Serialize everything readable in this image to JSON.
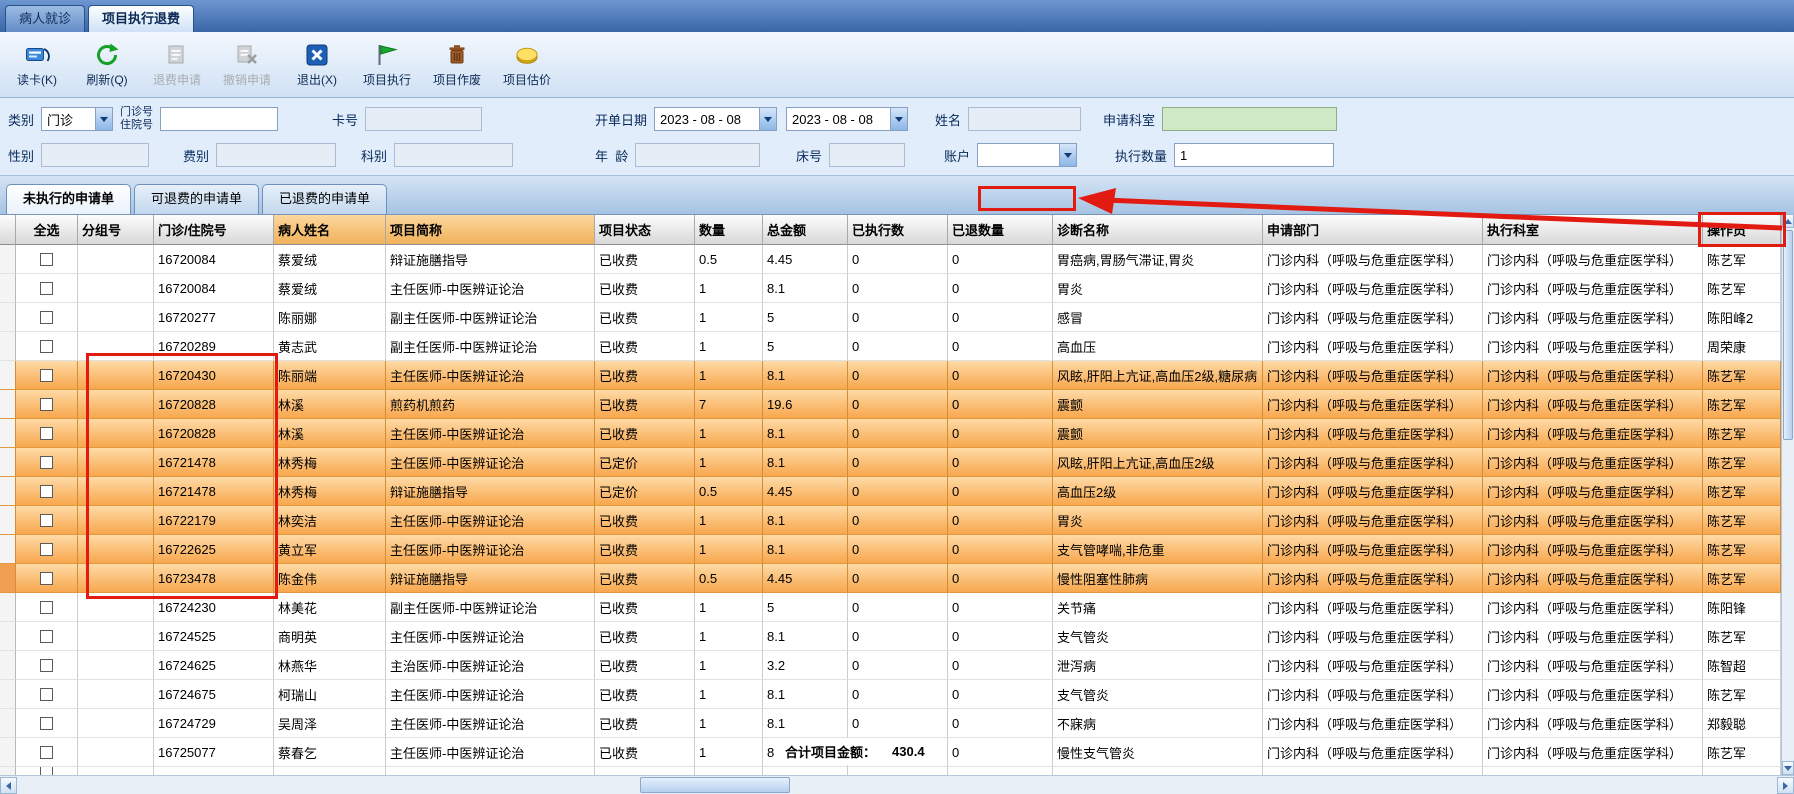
{
  "top_tabs": [
    {
      "label": "病人就诊",
      "active": false
    },
    {
      "label": "项目执行退费",
      "active": true
    }
  ],
  "toolbar": {
    "buttons": [
      {
        "label": "读卡(K)",
        "icon": "card-reader-icon",
        "enabled": true
      },
      {
        "label": "刷新(Q)",
        "icon": "refresh-icon",
        "enabled": true
      },
      {
        "label": "退费申请",
        "icon": "refund-request-icon",
        "enabled": false
      },
      {
        "label": "撤销申请",
        "icon": "cancel-request-icon",
        "enabled": false
      },
      {
        "label": "退出(X)",
        "icon": "exit-icon",
        "enabled": true
      },
      {
        "label": "项目执行",
        "icon": "execute-icon",
        "enabled": true
      },
      {
        "label": "项目作废",
        "icon": "void-icon",
        "enabled": true
      },
      {
        "label": "项目估价",
        "icon": "estimate-icon",
        "enabled": true
      }
    ]
  },
  "form": {
    "category": {
      "label": "类别",
      "value": "门诊"
    },
    "visit_no": {
      "label": "门诊号\n住院号",
      "value": ""
    },
    "card_no": {
      "label": "卡号",
      "value": ""
    },
    "order_date": {
      "label": "开单日期",
      "from": "2023 - 08 - 08",
      "to": "2023 - 08 - 08"
    },
    "patient_name": {
      "label": "姓名",
      "value": ""
    },
    "apply_dept": {
      "label": "申请科室",
      "value": ""
    },
    "gender": {
      "label": "性别",
      "value": ""
    },
    "fee_type": {
      "label": "费别",
      "value": ""
    },
    "section": {
      "label": "科别",
      "value": ""
    },
    "age": {
      "label": "年  龄",
      "value": ""
    },
    "bed_no": {
      "label": "床号",
      "value": ""
    },
    "account": {
      "label": "账户",
      "value": ""
    },
    "exec_count": {
      "label": "执行数量",
      "value": "1"
    }
  },
  "sub_tabs": [
    {
      "label": "未执行的申请单",
      "active": true
    },
    {
      "label": "可退费的申请单",
      "active": false
    },
    {
      "label": "已退费的申请单",
      "active": false
    }
  ],
  "table": {
    "select_all_label": "全选",
    "columns": [
      {
        "key": "group",
        "label": "分组号",
        "highlighted": false
      },
      {
        "key": "id",
        "label": "门诊/住院号",
        "highlighted": false
      },
      {
        "key": "name",
        "label": "病人姓名",
        "highlighted": true
      },
      {
        "key": "item",
        "label": "项目简称",
        "highlighted": true
      },
      {
        "key": "status",
        "label": "项目状态",
        "highlighted": false
      },
      {
        "key": "qty",
        "label": "数量",
        "highlighted": false
      },
      {
        "key": "amount",
        "label": "总金额",
        "highlighted": false
      },
      {
        "key": "executed",
        "label": "已执行数",
        "highlighted": false
      },
      {
        "key": "refunded",
        "label": "已退数量",
        "highlighted": false
      },
      {
        "key": "diagnosis",
        "label": "诊断名称",
        "highlighted": false
      },
      {
        "key": "dept",
        "label": "申请部门",
        "highlighted": false
      },
      {
        "key": "exec_dept",
        "label": "执行科室",
        "highlighted": false
      },
      {
        "key": "operator",
        "label": "操作员",
        "highlighted": false
      }
    ],
    "rows": [
      {
        "group": "",
        "id": "16720084",
        "name": "蔡爱绒",
        "item": "辩证施膳指导",
        "status": "已收费",
        "qty": "0.5",
        "amount": "4.45",
        "executed": "0",
        "refunded": "0",
        "diagnosis": "胃癌病,胃肠气滞证,胃炎",
        "dept": "门诊内科（呼吸与危重症医学科）",
        "exec_dept": "门诊内科（呼吸与危重症医学科）",
        "operator": "陈艺军",
        "highlighted": false,
        "current": false
      },
      {
        "group": "",
        "id": "16720084",
        "name": "蔡爱绒",
        "item": "主任医师-中医辨证论治",
        "status": "已收费",
        "qty": "1",
        "amount": "8.1",
        "executed": "0",
        "refunded": "0",
        "diagnosis": "胃炎",
        "dept": "门诊内科（呼吸与危重症医学科）",
        "exec_dept": "门诊内科（呼吸与危重症医学科）",
        "operator": "陈艺军",
        "highlighted": false,
        "current": false
      },
      {
        "group": "",
        "id": "16720277",
        "name": "陈丽娜",
        "item": "副主任医师-中医辨证论治",
        "status": "已收费",
        "qty": "1",
        "amount": "5",
        "executed": "0",
        "refunded": "0",
        "diagnosis": "感冒",
        "dept": "门诊内科（呼吸与危重症医学科）",
        "exec_dept": "门诊内科（呼吸与危重症医学科）",
        "operator": "陈阳峰2",
        "highlighted": false,
        "current": false
      },
      {
        "group": "",
        "id": "16720289",
        "name": "黄志武",
        "item": "副主任医师-中医辨证论治",
        "status": "已收费",
        "qty": "1",
        "amount": "5",
        "executed": "0",
        "refunded": "0",
        "diagnosis": "高血压",
        "dept": "门诊内科（呼吸与危重症医学科）",
        "exec_dept": "门诊内科（呼吸与危重症医学科）",
        "operator": "周荣康",
        "highlighted": false,
        "current": false
      },
      {
        "group": "",
        "id": "16720430",
        "name": "陈丽端",
        "item": "主任医师-中医辨证论治",
        "status": "已收费",
        "qty": "1",
        "amount": "8.1",
        "executed": "0",
        "refunded": "0",
        "diagnosis": "风眩,肝阳上亢证,高血压2级,糖尿病",
        "dept": "门诊内科（呼吸与危重症医学科）",
        "exec_dept": "门诊内科（呼吸与危重症医学科）",
        "operator": "陈艺军",
        "highlighted": true,
        "current": false
      },
      {
        "group": "",
        "id": "16720828",
        "name": "林溪",
        "item": "煎药机煎药",
        "status": "已收费",
        "qty": "7",
        "amount": "19.6",
        "executed": "0",
        "refunded": "0",
        "diagnosis": "震颤",
        "dept": "门诊内科（呼吸与危重症医学科）",
        "exec_dept": "门诊内科（呼吸与危重症医学科）",
        "operator": "陈艺军",
        "highlighted": true,
        "current": false
      },
      {
        "group": "",
        "id": "16720828",
        "name": "林溪",
        "item": "主任医师-中医辨证论治",
        "status": "已收费",
        "qty": "1",
        "amount": "8.1",
        "executed": "0",
        "refunded": "0",
        "diagnosis": "震颤",
        "dept": "门诊内科（呼吸与危重症医学科）",
        "exec_dept": "门诊内科（呼吸与危重症医学科）",
        "operator": "陈艺军",
        "highlighted": true,
        "current": false
      },
      {
        "group": "",
        "id": "16721478",
        "name": "林秀梅",
        "item": "主任医师-中医辨证论治",
        "status": "已定价",
        "qty": "1",
        "amount": "8.1",
        "executed": "0",
        "refunded": "0",
        "diagnosis": "风眩,肝阳上亢证,高血压2级",
        "dept": "门诊内科（呼吸与危重症医学科）",
        "exec_dept": "门诊内科（呼吸与危重症医学科）",
        "operator": "陈艺军",
        "highlighted": true,
        "current": false
      },
      {
        "group": "",
        "id": "16721478",
        "name": "林秀梅",
        "item": "辩证施膳指导",
        "status": "已定价",
        "qty": "0.5",
        "amount": "4.45",
        "executed": "0",
        "refunded": "0",
        "diagnosis": "高血压2级",
        "dept": "门诊内科（呼吸与危重症医学科）",
        "exec_dept": "门诊内科（呼吸与危重症医学科）",
        "operator": "陈艺军",
        "highlighted": true,
        "current": false
      },
      {
        "group": "",
        "id": "16722179",
        "name": "林奕洁",
        "item": "主任医师-中医辨证论治",
        "status": "已收费",
        "qty": "1",
        "amount": "8.1",
        "executed": "0",
        "refunded": "0",
        "diagnosis": "胃炎",
        "dept": "门诊内科（呼吸与危重症医学科）",
        "exec_dept": "门诊内科（呼吸与危重症医学科）",
        "operator": "陈艺军",
        "highlighted": true,
        "current": false
      },
      {
        "group": "",
        "id": "16722625",
        "name": "黄立军",
        "item": "主任医师-中医辨证论治",
        "status": "已收费",
        "qty": "1",
        "amount": "8.1",
        "executed": "0",
        "refunded": "0",
        "diagnosis": "支气管哮喘,非危重",
        "dept": "门诊内科（呼吸与危重症医学科）",
        "exec_dept": "门诊内科（呼吸与危重症医学科）",
        "operator": "陈艺军",
        "highlighted": true,
        "current": false
      },
      {
        "group": "",
        "id": "16723478",
        "name": "陈金伟",
        "item": "辩证施膳指导",
        "status": "已收费",
        "qty": "0.5",
        "amount": "4.45",
        "executed": "0",
        "refunded": "0",
        "diagnosis": "慢性阻塞性肺病",
        "dept": "门诊内科（呼吸与危重症医学科）",
        "exec_dept": "门诊内科（呼吸与危重症医学科）",
        "operator": "陈艺军",
        "highlighted": true,
        "current": true
      },
      {
        "group": "",
        "id": "16724230",
        "name": "林美花",
        "item": "副主任医师-中医辨证论治",
        "status": "已收费",
        "qty": "1",
        "amount": "5",
        "executed": "0",
        "refunded": "0",
        "diagnosis": "关节痛",
        "dept": "门诊内科（呼吸与危重症医学科）",
        "exec_dept": "门诊内科（呼吸与危重症医学科）",
        "operator": "陈阳锋",
        "highlighted": false,
        "current": false
      },
      {
        "group": "",
        "id": "16724525",
        "name": "商明英",
        "item": "主任医师-中医辨证论治",
        "status": "已收费",
        "qty": "1",
        "amount": "8.1",
        "executed": "0",
        "refunded": "0",
        "diagnosis": "支气管炎",
        "dept": "门诊内科（呼吸与危重症医学科）",
        "exec_dept": "门诊内科（呼吸与危重症医学科）",
        "operator": "陈艺军",
        "highlighted": false,
        "current": false
      },
      {
        "group": "",
        "id": "16724625",
        "name": "林燕华",
        "item": "主治医师-中医辨证论治",
        "status": "已收费",
        "qty": "1",
        "amount": "3.2",
        "executed": "0",
        "refunded": "0",
        "diagnosis": "泄泻病",
        "dept": "门诊内科（呼吸与危重症医学科）",
        "exec_dept": "门诊内科（呼吸与危重症医学科）",
        "operator": "陈智超",
        "highlighted": false,
        "current": false
      },
      {
        "group": "",
        "id": "16724675",
        "name": "柯瑞山",
        "item": "主任医师-中医辨证论治",
        "status": "已收费",
        "qty": "1",
        "amount": "8.1",
        "executed": "0",
        "refunded": "0",
        "diagnosis": "支气管炎",
        "dept": "门诊内科（呼吸与危重症医学科）",
        "exec_dept": "门诊内科（呼吸与危重症医学科）",
        "operator": "陈艺军",
        "highlighted": false,
        "current": false
      },
      {
        "group": "",
        "id": "16724729",
        "name": "吴周泽",
        "item": "主任医师-中医辨证论治",
        "status": "已收费",
        "qty": "1",
        "amount": "8.1",
        "executed": "0",
        "refunded": "0",
        "diagnosis": "不寐病",
        "dept": "门诊内科（呼吸与危重症医学科）",
        "exec_dept": "门诊内科（呼吸与危重症医学科）",
        "operator": "郑毅聪",
        "highlighted": false,
        "current": false
      },
      {
        "group": "",
        "id": "16725077",
        "name": "蔡春乞",
        "item": "主任医师-中医辨证论治",
        "status": "已收费",
        "qty": "1",
        "amount": "8",
        "executed": "0",
        "refunded": "0",
        "diagnosis": "慢性支气管炎",
        "dept": "门诊内科（呼吸与危重症医学科）",
        "exec_dept": "门诊内科（呼吸与危重症医学科）",
        "operator": "陈艺军",
        "highlighted": false,
        "current": false
      }
    ],
    "summary": {
      "label": "合计项目金额：",
      "value": "430.4"
    }
  },
  "annotations": {
    "color": "#e11b12",
    "items": [
      "ids-column-box",
      "blank-callout-box",
      "operator-header-box",
      "arrow-to-callout"
    ]
  }
}
